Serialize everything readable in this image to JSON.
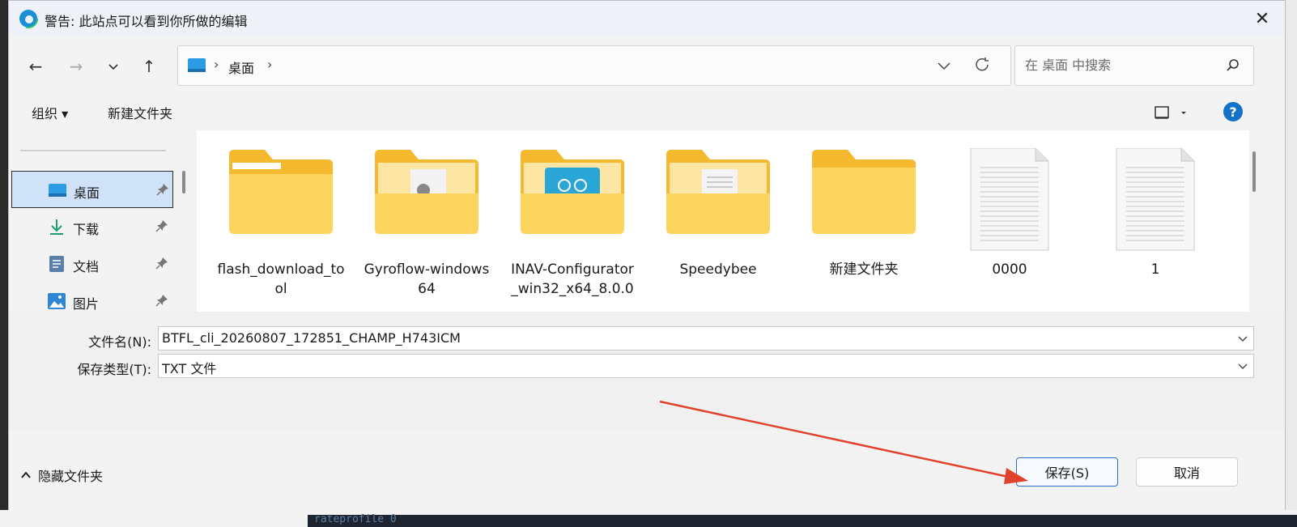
{
  "window": {
    "title": "警告: 此站点可以看到你所做的编辑",
    "close_glyph": "✕"
  },
  "nav": {
    "back_glyph": "←",
    "forward_glyph": "→",
    "recent_glyph": "⌄",
    "up_glyph": "↑"
  },
  "address": {
    "crumb": "桌面",
    "sep": "›"
  },
  "search": {
    "placeholder": "在 桌面 中搜索"
  },
  "toolbar": {
    "organize": "组织 ▾",
    "new_folder": "新建文件夹",
    "help": "?"
  },
  "sidebar": {
    "items": [
      {
        "label": "桌面",
        "icon": "desktop-icon",
        "selected": true
      },
      {
        "label": "下载",
        "icon": "download-icon"
      },
      {
        "label": "文档",
        "icon": "documents-icon"
      },
      {
        "label": "图片",
        "icon": "pictures-icon"
      }
    ]
  },
  "files": [
    {
      "name": "flash_download_tool",
      "type": "folder"
    },
    {
      "name": "Gyroflow-windows64",
      "type": "folder"
    },
    {
      "name": "INAV-Configurator_win32_x64_8.0.0",
      "type": "folder"
    },
    {
      "name": "Speedybee",
      "type": "folder"
    },
    {
      "name": "新建文件夹",
      "type": "folder"
    },
    {
      "name": "0000",
      "type": "text-file"
    },
    {
      "name": "1",
      "type": "text-file"
    }
  ],
  "form": {
    "filename_label": "文件名(N):",
    "filename_value": "BTFL_cli_20260807_172851_CHAMP_H743ICM",
    "filetype_label": "保存类型(T):",
    "filetype_value": "TXT 文件"
  },
  "footer": {
    "hide_folders": "隐藏文件夹",
    "save": "保存(S)",
    "cancel": "取消"
  },
  "background": {
    "code_snippet": "rateprofile 0"
  },
  "colors": {
    "accent": "#1473c9",
    "annotation_arrow": "#e0422b",
    "folder": "#f7c948"
  }
}
